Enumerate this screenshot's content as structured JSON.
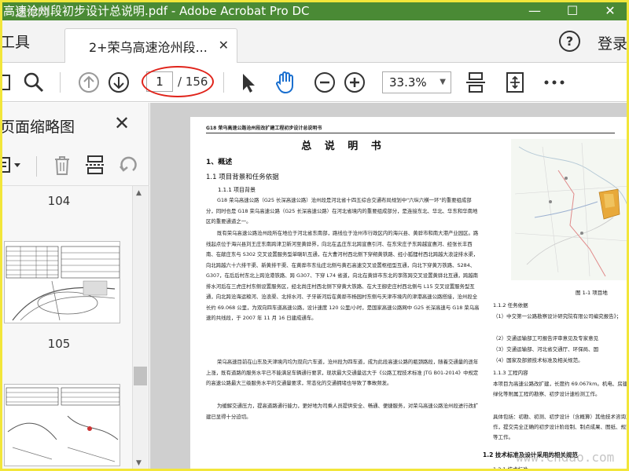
{
  "window": {
    "title": "高速沧州段初步设计总说明.pdf - Adobe Acrobat Pro DC",
    "minimize": "—",
    "maximize": "☐",
    "close": "✕"
  },
  "tabs": {
    "tools": "工具",
    "document_tab": "2+荣乌高速沧州段...",
    "help": "?",
    "login": "登录"
  },
  "toolbar": {
    "page_current": "1",
    "page_total": "/ 156",
    "zoom": "33.3%"
  },
  "panel": {
    "title": "页面缩略图",
    "thumbnails": [
      {
        "number": "104"
      },
      {
        "number": "105"
      }
    ]
  },
  "document": {
    "running_head": "G18 荣乌高速公路沧州段改扩建工程初步设计总说明书",
    "title": "总 说 明 书",
    "h1_overview": "1、概述",
    "h2_background": "1.1 项目背景和任务依据",
    "h3_background": "1.1.1 项目背景",
    "para1": "G18 荣乌高速公路（G25 长深高速公路）沧州段是河北省十四五综合交通布局规划中\"六纵六横一环\"的重要组成部分，同时也是 G18 荣乌高速公路（G25 长深高速公路）在河北省境内的重要组成部分，是连接东北、华北、华东和华南地区的重要通道之一。",
    "para2": "既有荣乌高速公路沧州段所在地位于河北省东南部，路线位于沧州市行政区内的海兴县、黄骅市和南大港产业园区。路线起点位于海兴县刘王庄东南跨津卫新河至黄骅界，向北在孟庄东北跨宣惠引河、在东宋庄子东跨越宣惠河、经张长丰西南、在献庄东与 S302 交叉设置服务型单喇叭互通，在大曹河村西北侧下穿朔黄铁路、经小狐狸村西北跨越大浪淀排水渠，向北跨越六十六排干渠、新黄排干渠、在黄骅市东仙庄北侧与黄石高速交叉设置枢纽型互通，向北下穿黄万铁路、S284、G307，在后后村东北上跨沧港铁路、跨 G307、下穿 L74 省道，向北在黄骅市东北的李陈跨交叉设置黄骅北互通，跨越南排水河后在三虎庄村东侧设置服务区，经北尚庄村西北侧下穿黄大铁路、在大王御史庄村西北侧与 L15 交叉设置服务型互通，向北跨沧海运粮河、沧浪渠、北排水河、子牙新河后在黄骅市杨园村东侧与天津市境内的津港高速公路搭接，沧州段全长约 69.068 公里，为双向四车道高速公路，设计速度 120 公里/小时，是国家高速公路网中 G25 长深高速与 G18 荣乌高速的共线段，于 2007 年 11 月 16 日建成通车。",
    "para3": "荣乌高速目前在山东及天津境内均为双向六车道，沧州段为四车道，成为此段高速公路的瓶颈路段，随着交通量的逐年上涨，既有道路的服务水平已不能满足车辆通行要求，现状最大交通量远大于《公路工程技术标准 JTG B01-2014》中规定的高速公路最大三级服务水平的交通量要求，常态化的交通拥堵也导致了事故频发。",
    "para4": "为缓解交通压力，提高道路通行能力，更好地为司乘人员提供安全、畅通、便捷服务，对荣乌高速公路沧州段进行改扩建已显得十分迫切。",
    "fig_caption": "图 1-1 项目地",
    "h3_basis": "1.1.2 任务依据",
    "basis_1": "（1）中交第一公路勘察设计研究院有限公司编究报告》；",
    "basis_2": "（2）交通运输部工可报告评审意见及专家意见",
    "basis_3": "（3）交通运输部、河北省交通厅、环保局、国",
    "basis_4": "（4）国家及部颁技术标准及相关规范。",
    "h3_process": "1.1.3 工程内容",
    "process_text": "本项目为高速公路改扩建，长度约 69.067km。机电、房建、绿化等附属工程的勘察、初步设计速检测工作。",
    "process_text2": "具体包括：初勘、初测、初步设计（含概算）其他技术咨询工作，提交完全正确的初步设计阶段制、制点成果、图纸、规范等工作。",
    "h2_standards": "1.2 技术标准及设计采用的相关规范",
    "h3_standards": "1.2.1 技术标准"
  },
  "watermarks": {
    "top": "送你网",
    "bottom": "www.cndao.com"
  },
  "colors": {
    "titlebar": "#4a8a35",
    "annotation": "#e0231a",
    "frame": "#f2e63a"
  }
}
